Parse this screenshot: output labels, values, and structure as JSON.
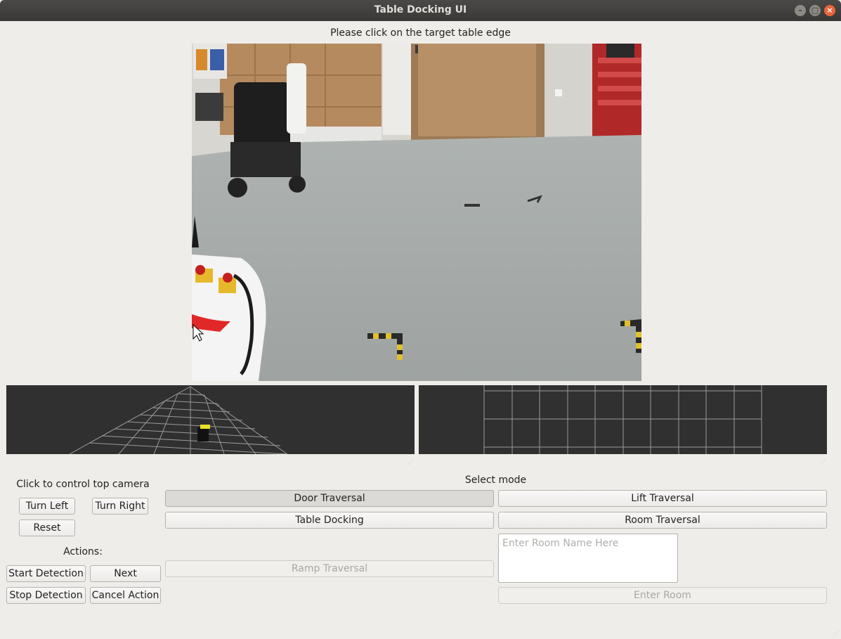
{
  "window": {
    "title": "Table Docking UI"
  },
  "camera": {
    "prompt": "Please click on the target table edge"
  },
  "top_camera": {
    "heading": "Click to control top camera",
    "turn_left": "Turn Left",
    "turn_right": "Turn Right",
    "reset": "Reset"
  },
  "actions": {
    "heading": "Actions:",
    "start_detection": "Start Detection",
    "next": "Next",
    "stop_detection": "Stop Detection",
    "cancel_action": "Cancel Action"
  },
  "modes": {
    "heading": "Select mode",
    "door_traversal": "Door Traversal",
    "lift_traversal": "Lift Traversal",
    "table_docking": "Table Docking",
    "room_traversal": "Room Traversal",
    "ramp_traversal": "Ramp Traversal",
    "room_name_placeholder": "Enter Room Name Here",
    "enter_room": "Enter Room"
  },
  "colors": {
    "titlebar": "#3d3c3a",
    "background": "#efede9",
    "viewport": "#303030",
    "close_button": "#e8663d"
  }
}
